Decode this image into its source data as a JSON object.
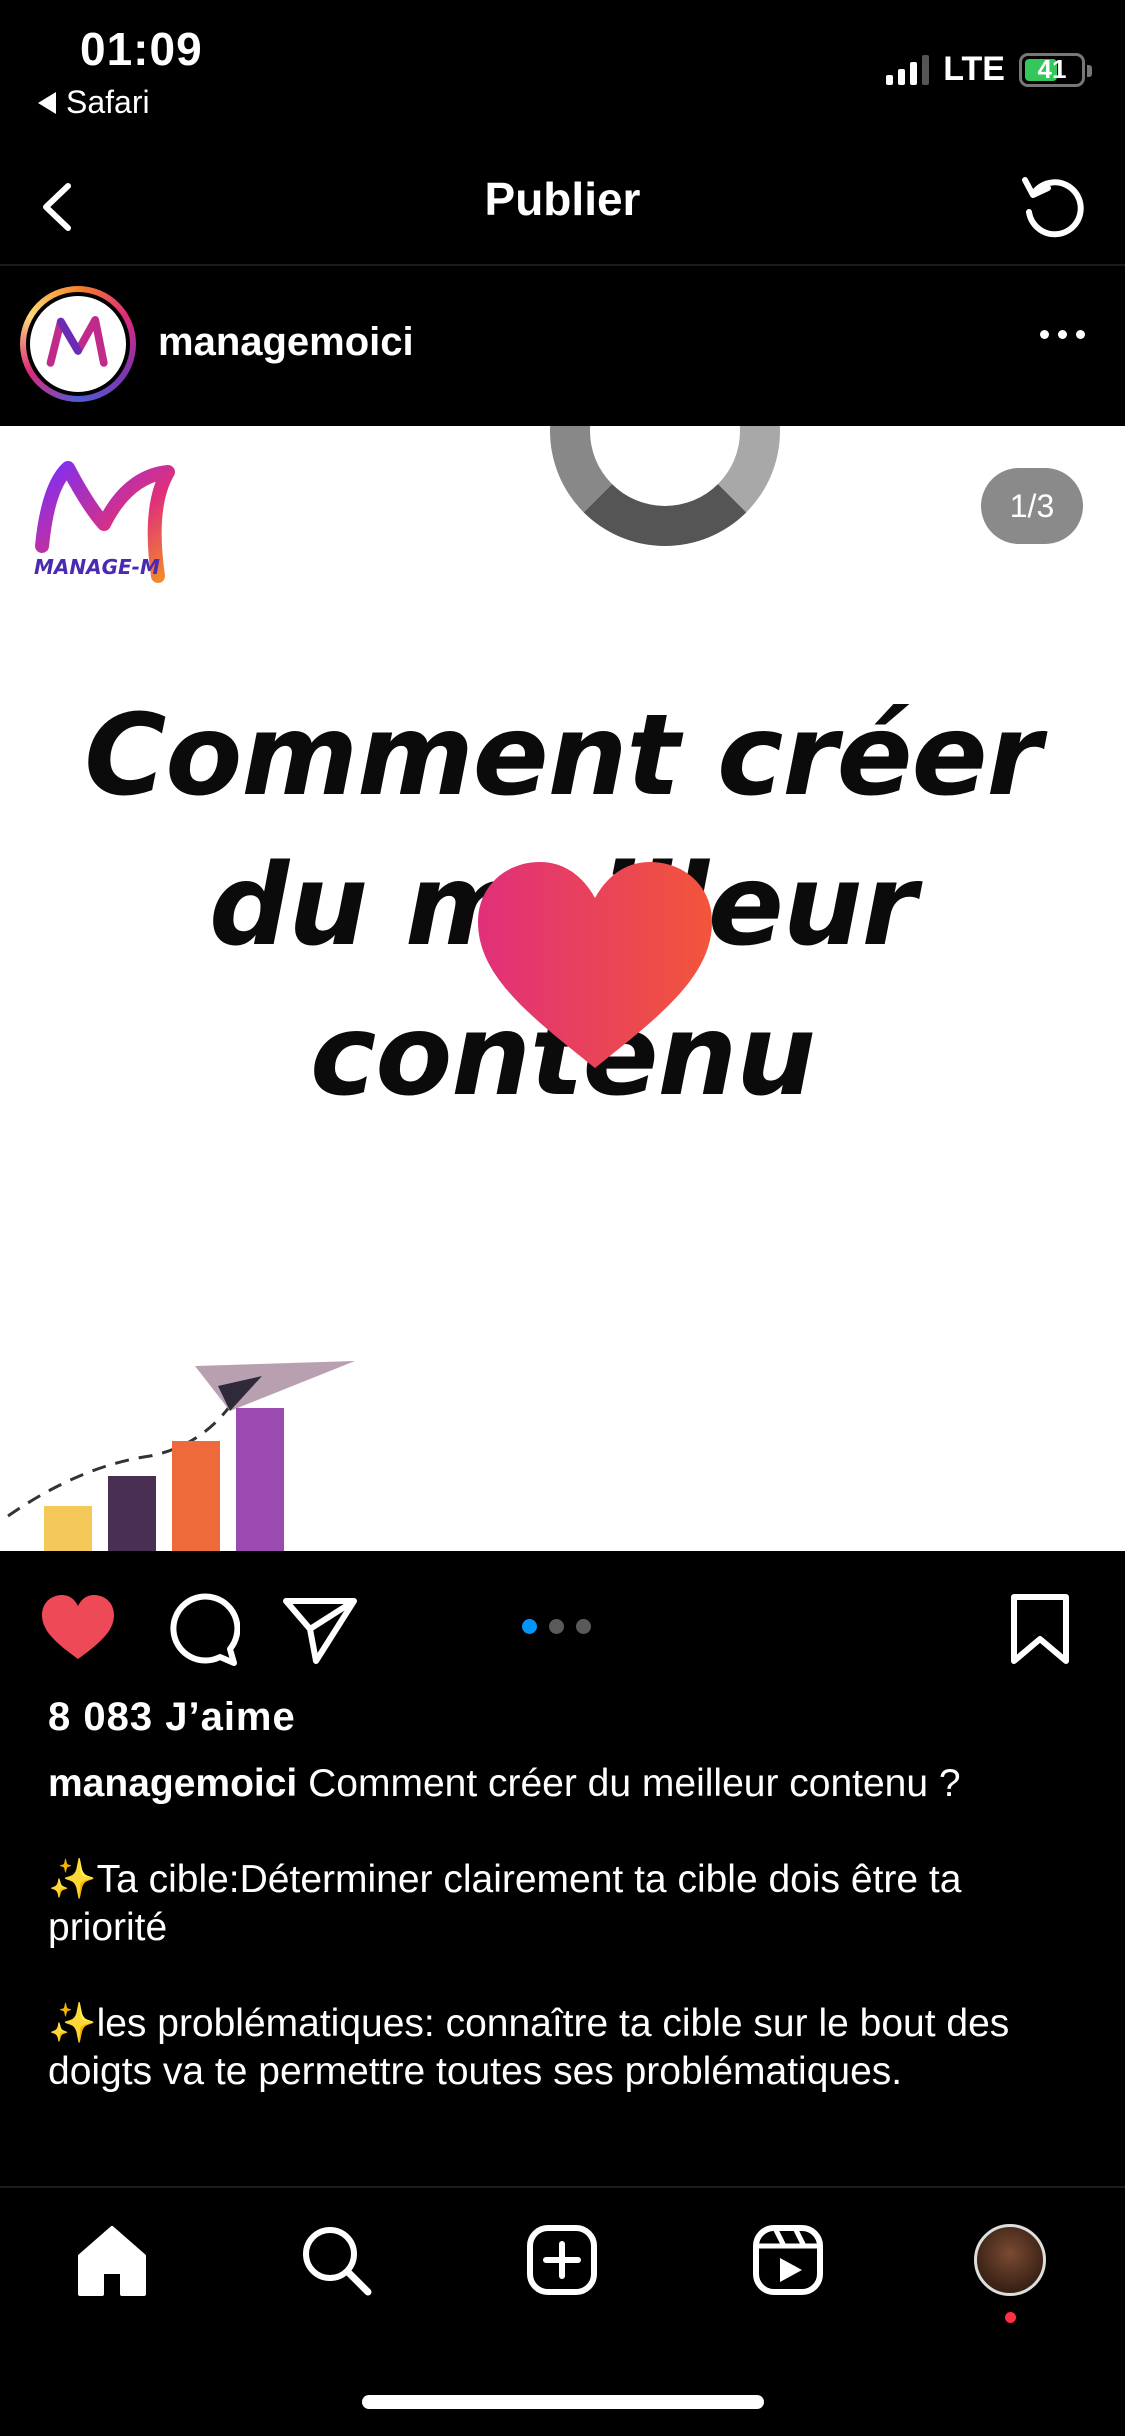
{
  "status_bar": {
    "time": "01:09",
    "back_app": "Safari",
    "network": "LTE",
    "battery": "41"
  },
  "header": {
    "title": "Publier",
    "back_icon": "chevron-left-icon",
    "refresh_icon": "refresh-icon"
  },
  "post": {
    "username": "managemoici",
    "slide_counter": "1/3",
    "headline_line1": "Comment créer",
    "headline_line2": "du meilleur",
    "headline_line3": "contenu",
    "logo_text": "MANAGE-M",
    "slide_count": 3,
    "active_slide": 1
  },
  "actions": {
    "liked": true,
    "like_color": "#ed4956",
    "dot_active_color": "#0095f6"
  },
  "likes_text": "8 083 J’aime",
  "caption": {
    "username": "managemoici",
    "text": "Comment créer du meilleur contenu ?",
    "para1_icon": "✨",
    "para1": "Ta cible:Déterminer clairement ta cible dois être ta priorité",
    "para2_icon": "✨",
    "para2": "les problématiques: connaître ta cible sur le bout des doigts va te permettre toutes ses problématiques."
  },
  "tabbar": {
    "items": [
      "home",
      "search",
      "create",
      "reels",
      "profile"
    ]
  }
}
